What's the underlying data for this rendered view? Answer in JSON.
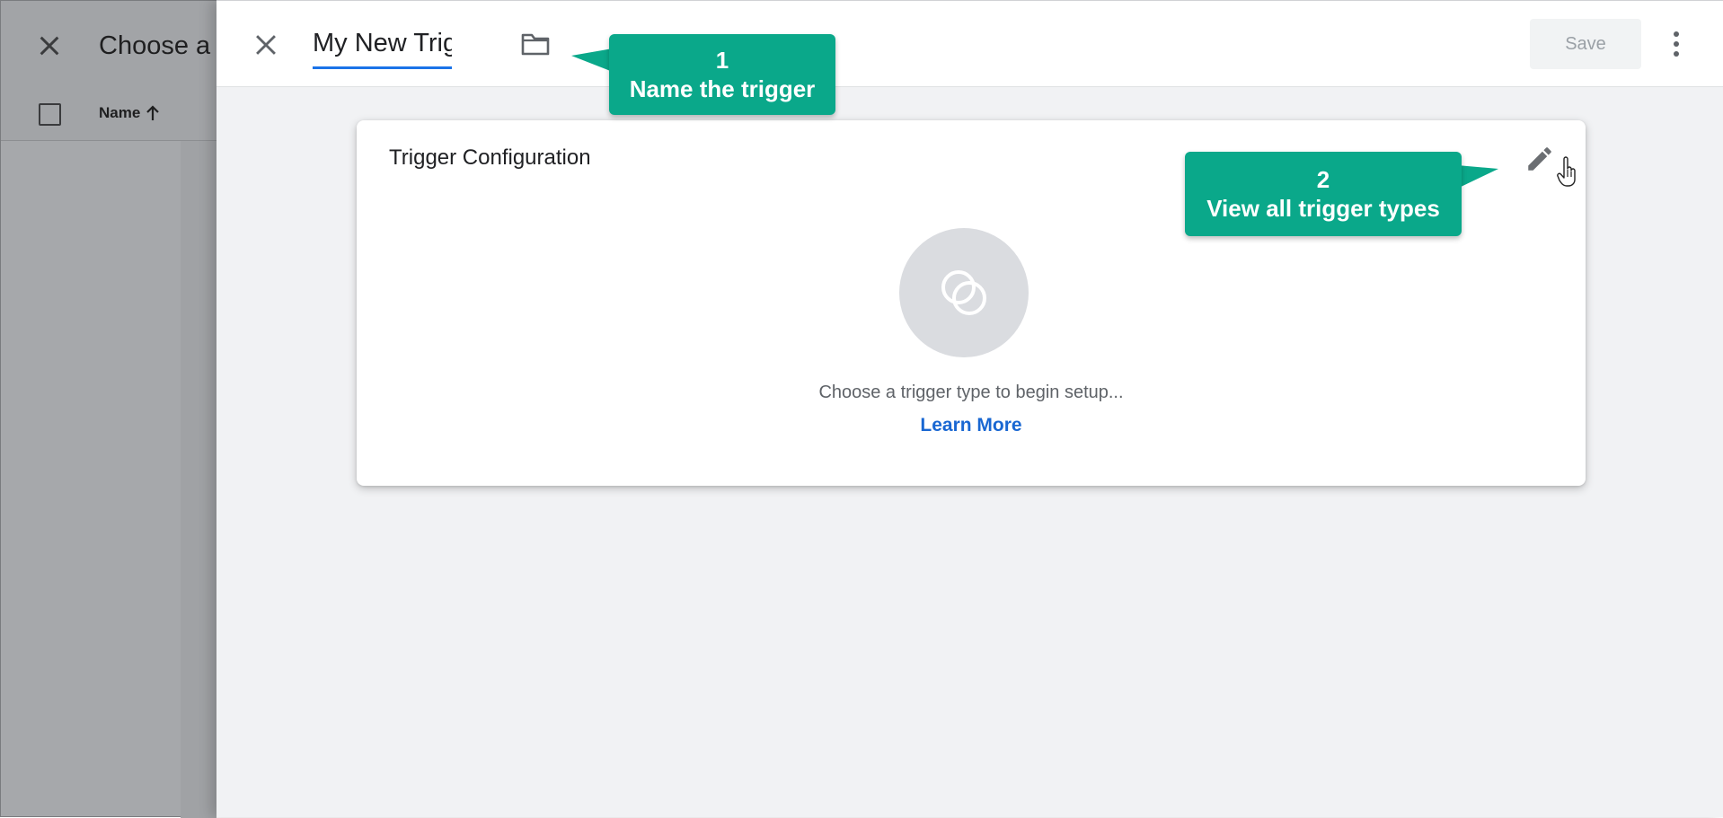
{
  "background": {
    "title": "Choose a",
    "column_name": "Name",
    "sort_icon": "arrow-up-icon",
    "close_icon": "close-icon"
  },
  "sheet": {
    "trigger_name": "My New Trigger",
    "folder_icon": "folder-icon",
    "close_icon": "close-icon",
    "save_label": "Save",
    "more_icon": "more-vert-icon"
  },
  "card": {
    "title": "Trigger Configuration",
    "edit_icon": "pencil-icon",
    "placeholder_icon": "trigger-circles-icon",
    "hint": "Choose a trigger type to begin setup...",
    "learn_more": "Learn More"
  },
  "callouts": [
    {
      "number": "1",
      "text": "Name the trigger"
    },
    {
      "number": "2",
      "text": "View all trigger types"
    }
  ],
  "colors": {
    "accent": "#1a73e8",
    "link": "#1967d2",
    "callout": "#0aa88a",
    "overlay": "#a6a8ab"
  }
}
